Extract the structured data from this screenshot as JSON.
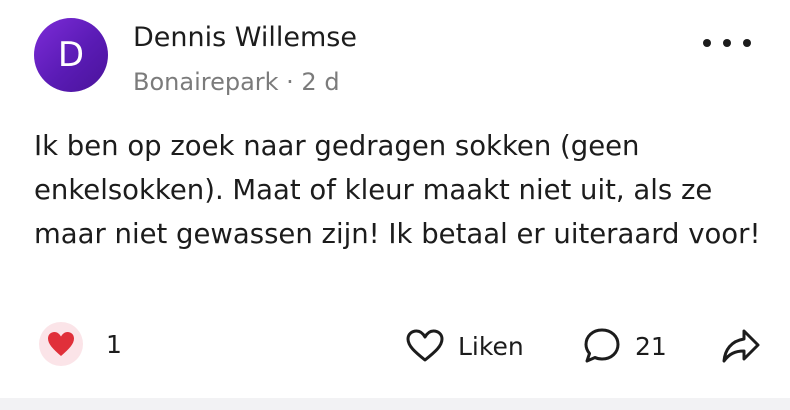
{
  "post": {
    "author": {
      "initial": "D",
      "name": "Dennis Willemse"
    },
    "meta": "Bonairepark · 2 d",
    "body": "Ik ben op zoek naar gedragen sokken (geen enkelsokken). Maat of kleur maakt niet uit, als ze maar niet gewassen zijn! Ik betaal er uiteraard voor!",
    "reactions": {
      "icon": "heart-icon",
      "count": "1"
    },
    "actions": {
      "like_label": "Liken",
      "comment_count": "21",
      "more_icon": "more-dots-icon",
      "comment_icon": "comment-bubble-icon",
      "share_icon": "share-arrow-icon"
    },
    "colors": {
      "avatar": "#6a22c8",
      "reaction_heart": "#e0303a",
      "reaction_bg": "#fbe4e8",
      "meta_text": "#7b7b7b"
    }
  }
}
